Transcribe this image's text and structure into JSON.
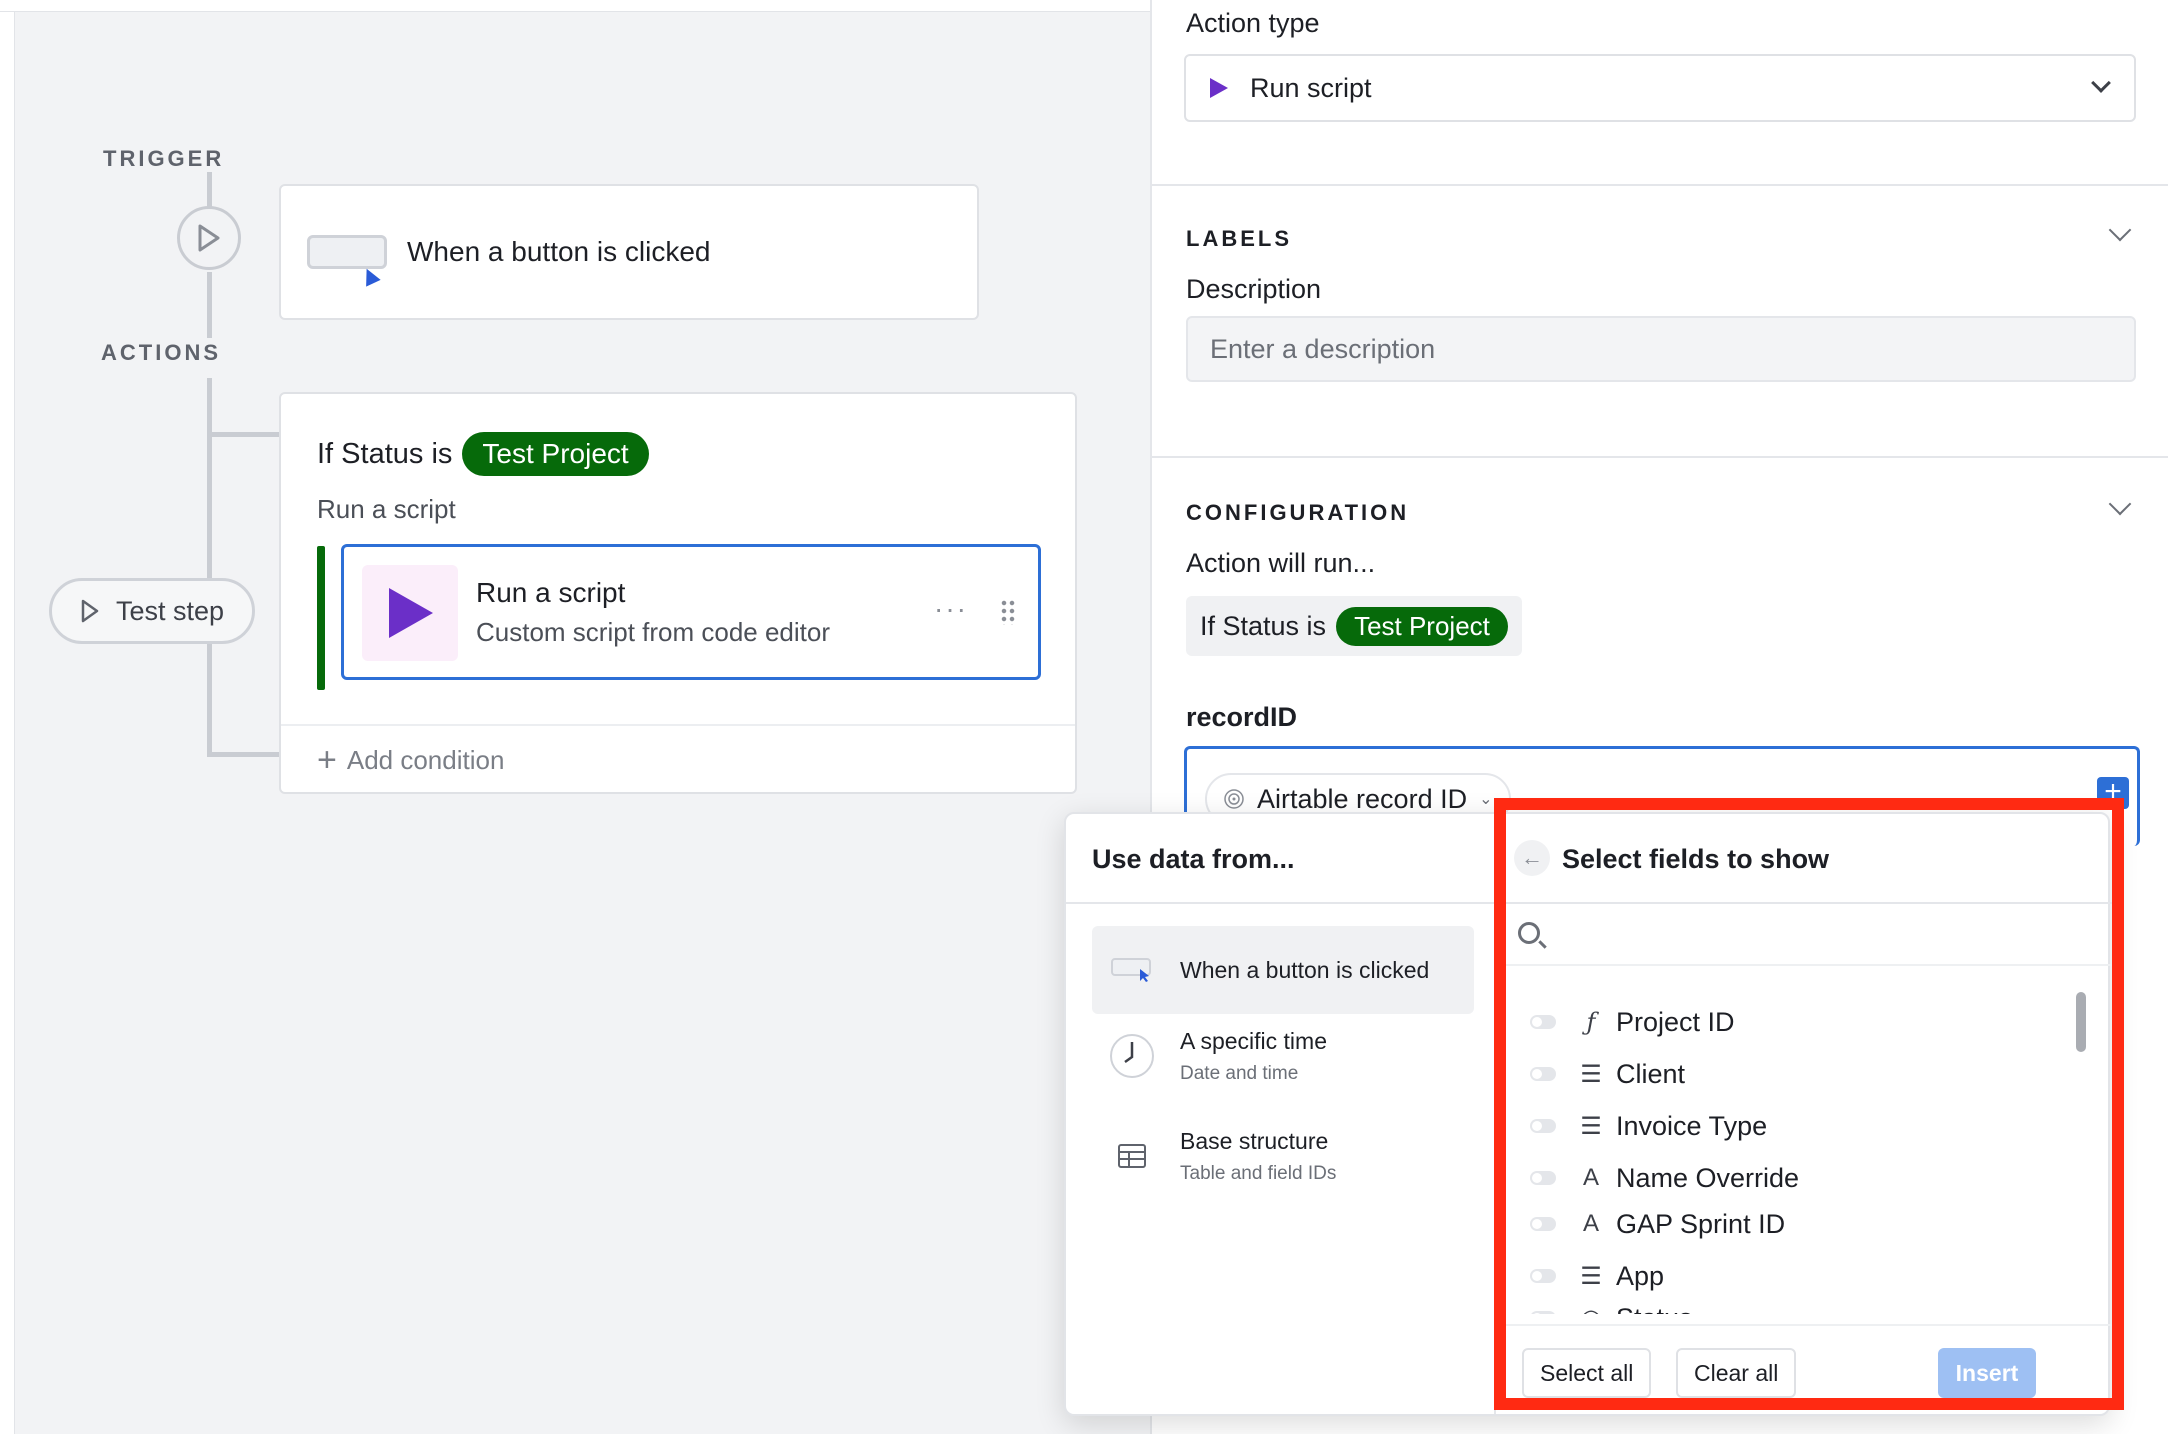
{
  "canvas": {
    "trigger_label": "TRIGGER",
    "actions_label": "ACTIONS",
    "trigger_text": "When a button is clicked",
    "condition_prefix": "If Status is",
    "condition_value": "Test Project",
    "condition_sub": "Run a script",
    "script_title": "Run a script",
    "script_desc": "Custom script from code editor",
    "script_more": "···",
    "add_condition": "Add condition",
    "test_step": "Test step"
  },
  "panel": {
    "action_type_label": "Action type",
    "action_type_value": "Run script",
    "labels_section": "LABELS",
    "description_label": "Description",
    "description_placeholder": "Enter a description",
    "configuration_section": "CONFIGURATION",
    "action_will_run": "Action will run...",
    "condition_prefix": "If Status is",
    "condition_value": "Test Project",
    "record_label": "recordID",
    "record_chip": "Airtable record ID"
  },
  "popover": {
    "left_title": "Use data from...",
    "sources": [
      {
        "main": "When a button is clicked",
        "sub": ""
      },
      {
        "main": "A specific time",
        "sub": "Date and time"
      },
      {
        "main": "Base structure",
        "sub": "Table and field IDs"
      }
    ],
    "right_title": "Select fields to show",
    "search_placeholder": "",
    "fields": [
      {
        "label": "Project ID",
        "icon": "formula-icon"
      },
      {
        "label": "Client",
        "icon": "link-icon"
      },
      {
        "label": "Invoice Type",
        "icon": "lookup-icon"
      },
      {
        "label": "Name Override",
        "icon": "text-icon"
      },
      {
        "label": "GAP Sprint ID",
        "icon": "text-icon"
      },
      {
        "label": "App",
        "icon": "link-icon"
      },
      {
        "label": "Status",
        "icon": "status-icon"
      }
    ],
    "select_all": "Select all",
    "clear_all": "Clear all",
    "insert": "Insert"
  },
  "colors": {
    "accent": "#2d6fd6",
    "pill_green": "#066a0a",
    "highlight": "#ff2a12",
    "script_purple": "#6b2fc8"
  }
}
